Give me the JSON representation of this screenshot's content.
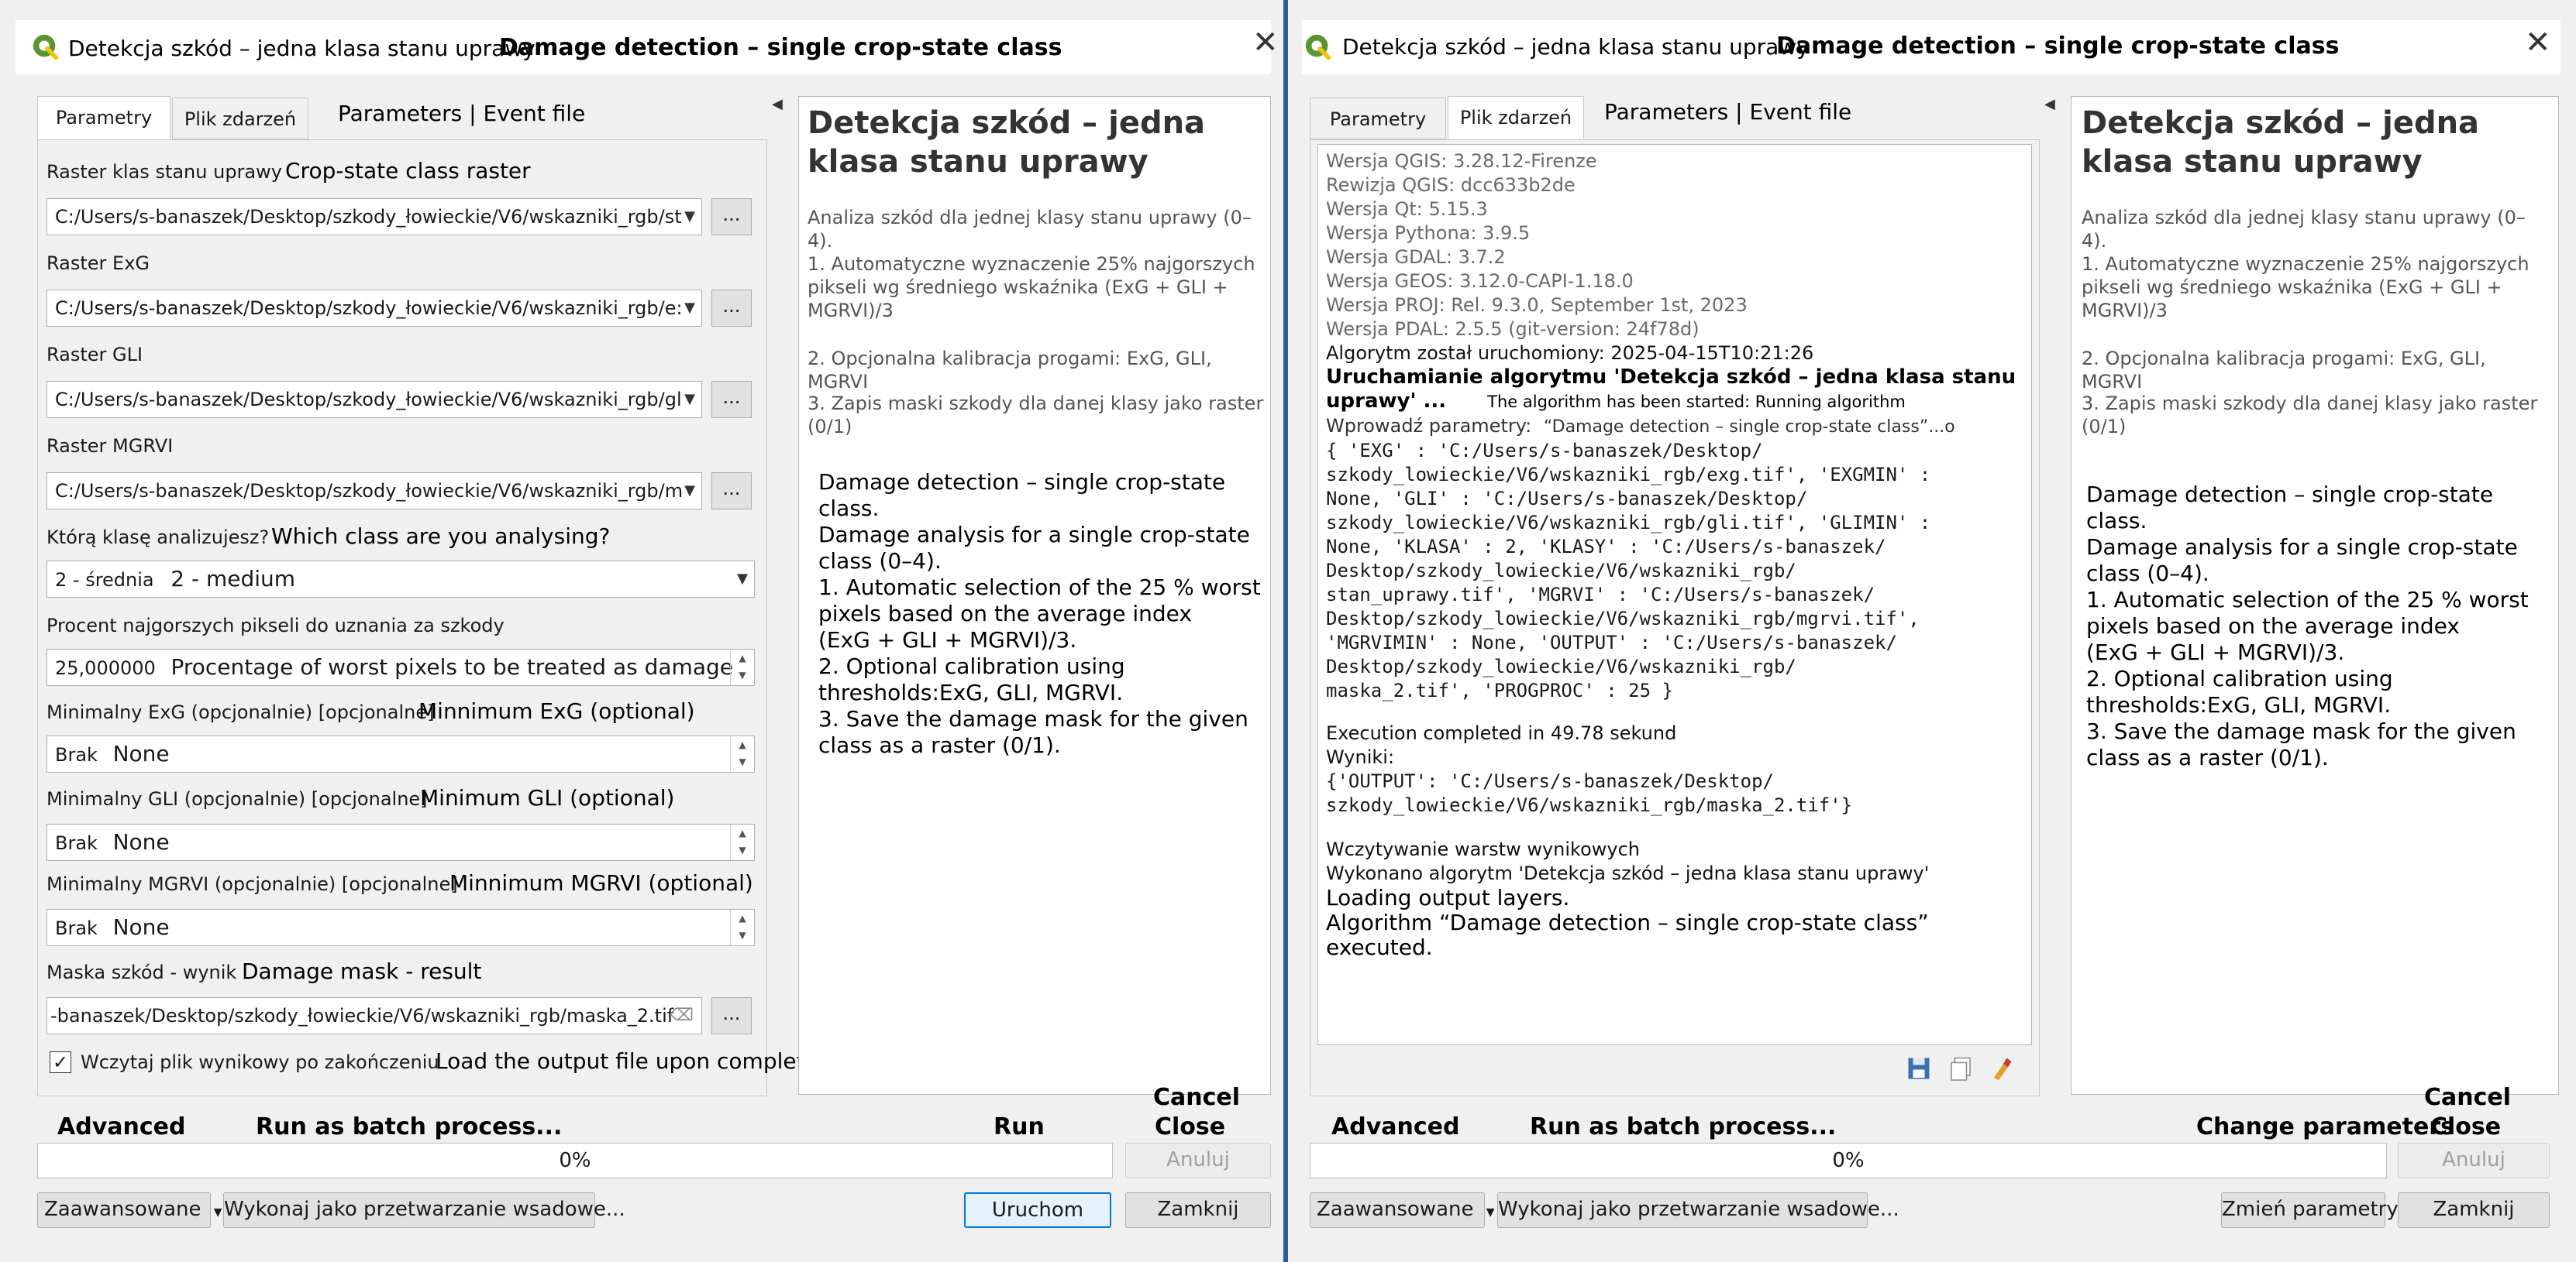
{
  "left": {
    "title_pl": "Detekcja szkód – jedna klasa stanu uprawy",
    "title_en": "Damage detection – single crop-state class",
    "tabs": [
      "Parametry",
      "Plik zdarzeń"
    ],
    "tabs_en": "Parameters | Event file",
    "params": {
      "raster_class": {
        "label_pl": "Raster klas stanu uprawy",
        "label_en": "Crop-state class raster",
        "value": "C:/Users/s-banaszek/Desktop/szkody_łowieckie/V6/wskazniki_rgb/st"
      },
      "raster_exg": {
        "label_pl": "Raster ExG",
        "value": "C:/Users/s-banaszek/Desktop/szkody_łowieckie/V6/wskazniki_rgb/e:"
      },
      "raster_gli": {
        "label_pl": "Raster GLI",
        "value": "C:/Users/s-banaszek/Desktop/szkody_łowieckie/V6/wskazniki_rgb/gl"
      },
      "raster_mgrvi": {
        "label_pl": "Raster MGRVI",
        "value": "C:/Users/s-banaszek/Desktop/szkody_łowieckie/V6/wskazniki_rgb/m"
      },
      "class_select": {
        "label_pl": "Którą klasę analizujesz?",
        "label_en": "Which class are you analysing?",
        "value_pl": "2 - średnia",
        "value_en": "2 - medium"
      },
      "percent": {
        "label_pl": "Procent najgorszych pikseli do uznania za szkody",
        "value": "25,000000",
        "value_en": "Procentage of worst pixels to be treated as damage"
      },
      "min_exg": {
        "label_pl": "Minimalny ExG (opcjonalnie) [opcjonalne]",
        "label_en": "Minnimum ExG (optional)",
        "value_pl": "Brak",
        "value_en": "None"
      },
      "min_gli": {
        "label_pl": "Minimalny GLI (opcjonalnie) [opcjonalne]",
        "label_en": "Minimum GLI (optional)",
        "value_pl": "Brak",
        "value_en": "None"
      },
      "min_mgrvi": {
        "label_pl": "Minimalny MGRVI (opcjonalnie) [opcjonalne]",
        "label_en": "Minnimum MGRVI (optional)",
        "value_pl": "Brak",
        "value_en": "None"
      },
      "output": {
        "label_pl": "Maska szkód - wynik",
        "label_en": "Damage mask - result",
        "value": "-banaszek/Desktop/szkody_łowieckie/V6/wskazniki_rgb/maska_2.tif"
      },
      "load_output": {
        "label_pl": "Wczytaj plik wynikowy po zakończeniu",
        "label_en": "Load the output file upon completion",
        "checked": true
      }
    },
    "browse_label": "...",
    "help": {
      "title": "Detekcja szkód – jedna klasa stanu uprawy",
      "intro": "Analiza szkód dla jednej klasy stanu uprawy (0–4).",
      "p1": "1. Automatyczne wyznaczenie 25% najgorszych pikseli wg średniego wskaźnika (ExG + GLI + MGRVI)/3",
      "p2": "2. Opcjonalna kalibracja progami: ExG, GLI, MGRVI",
      "p3": "3. Zapis maski szkody dla danej klasy jako raster (0/1)",
      "en_lines": [
        "Damage detection – single crop-state",
        "class.",
        "Damage analysis for a single crop-state",
        "class (0–4).",
        "1. Automatic selection of the 25 % worst",
        "pixels based on the average index",
        "(ExG + GLI + MGRVI)/3.",
        "2. Optional calibration using",
        "thresholds:ExG, GLI, MGRVI.",
        "3. Save the damage mask for the given",
        "class as a raster (0/1)."
      ]
    },
    "bottom_en": {
      "advanced": "Advanced",
      "batch": "Run as batch process...",
      "run": "Run",
      "cancel": "Cancel",
      "close": "Close"
    },
    "progress": "0%",
    "buttons": {
      "cancel": "Anuluj",
      "advanced": "Zaawansowane",
      "batch": "Wykonaj jako przetwarzanie wsadowe...",
      "run": "Uruchom",
      "close": "Zamknij"
    }
  },
  "right": {
    "title_pl": "Detekcja szkód – jedna klasa stanu uprawy",
    "title_en": "Damage detection – single crop-state class",
    "tabs": [
      "Parametry",
      "Plik zdarzeń"
    ],
    "tabs_en": "Parameters | Event file",
    "log_grey": [
      "Wersja QGIS: 3.28.12-Firenze",
      "Rewizja QGIS: dcc633b2de",
      "Wersja Qt: 5.15.3",
      "Wersja Pythona: 3.9.5",
      "Wersja GDAL: 3.7.2",
      "Wersja GEOS: 3.12.0-CAPI-1.18.0",
      "Wersja PROJ: Rel. 9.3.0, September 1st, 2023",
      "Wersja PDAL: 2.5.5 (git-version: 24f78d)"
    ],
    "log_started": "Algorytm został uruchomiony: 2025-04-15T10:21:26",
    "log_running_1": "Uruchamianie algorytmu 'Detekcja szkód – jedna klasa stanu",
    "log_running_2": "uprawy' ...",
    "log_running_en": "The algorithm has been started: Running algorithm",
    "log_params_label": "Wprowadź parametry:",
    "log_params_en": "“Damage detection – single crop-state class”...o",
    "log_params": [
      "{ 'EXG' : 'C:/Users/s-banaszek/Desktop/",
      "szkody_lowieckie/V6/wskazniki_rgb/exg.tif', 'EXGMIN' :",
      "None, 'GLI' : 'C:/Users/s-banaszek/Desktop/",
      "szkody_lowieckie/V6/wskazniki_rgb/gli.tif', 'GLIMIN' :",
      "None, 'KLASA' : 2, 'KLASY' : 'C:/Users/s-banaszek/",
      "Desktop/szkody_lowieckie/V6/wskazniki_rgb/",
      "stan_uprawy.tif', 'MGRVI' : 'C:/Users/s-banaszek/",
      "Desktop/szkody_lowieckie/V6/wskazniki_rgb/mgrvi.tif',",
      "'MGRVIMIN' : None, 'OUTPUT' : 'C:/Users/s-banaszek/",
      "Desktop/szkody_lowieckie/V6/wskazniki_rgb/",
      "maska_2.tif', 'PROGPROC' : 25 }"
    ],
    "log_exec": "Execution completed in 49.78 sekund",
    "log_results_label": "Wyniki:",
    "log_results": [
      "{'OUTPUT': 'C:/Users/s-banaszek/Desktop/",
      "szkody_lowieckie/V6/wskazniki_rgb/maska_2.tif'}"
    ],
    "log_loading": "Wczytywanie warstw wynikowych",
    "log_done": "Wykonano algorytm 'Detekcja szkód – jedna klasa stanu uprawy'",
    "log_en": [
      "Loading output layers.",
      "Algorithm “Damage detection – single crop-state class”",
      "executed."
    ],
    "help": {
      "title": "Detekcja szkód – jedna klasa stanu uprawy",
      "intro": "Analiza szkód dla jednej klasy stanu uprawy (0–4).",
      "p1": "1. Automatyczne wyznaczenie 25% najgorszych pikseli wg średniego wskaźnika (ExG + GLI + MGRVI)/3",
      "p2": "2. Opcjonalna kalibracja progami: ExG, GLI, MGRVI",
      "p3": "3. Zapis maski szkody dla danej klasy jako raster (0/1)",
      "en_lines": [
        "Damage detection – single crop-state",
        "class.",
        "Damage analysis for a single crop-state",
        "class (0–4).",
        "1. Automatic selection of the 25 % worst",
        "pixels based on the average index",
        "(ExG + GLI + MGRVI)/3.",
        "2. Optional calibration using",
        "thresholds:ExG, GLI, MGRVI.",
        "3. Save the damage mask for the given",
        "class as a raster (0/1)."
      ]
    },
    "bottom_en": {
      "advanced": "Advanced",
      "batch": "Run as batch process...",
      "change": "Change parameters",
      "cancel": "Cancel",
      "close": "Close"
    },
    "progress": "0%",
    "buttons": {
      "cancel": "Anuluj",
      "advanced": "Zaawansowane",
      "batch": "Wykonaj jako przetwarzanie wsadowe...",
      "change": "Zmień parametry",
      "close": "Zamknij"
    }
  },
  "colors": {
    "title_accent": "#2a5d9f",
    "qgis_green": "#589632",
    "qgis_yellow": "#f0c60b",
    "primary_border": "#0078d7"
  },
  "icons": [
    "qgis-logo-icon",
    "close-icon",
    "save-icon",
    "copy-icon",
    "clear-icon",
    "chevron-down-icon",
    "spin-icon",
    "collapse-arrow-icon"
  ]
}
